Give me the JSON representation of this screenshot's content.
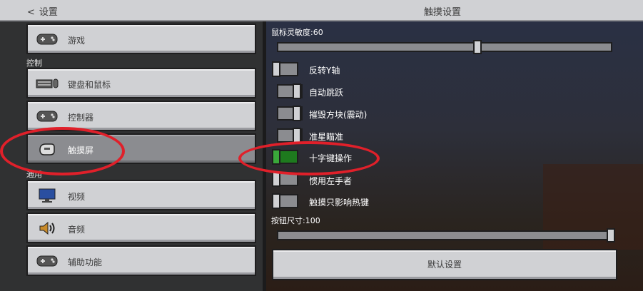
{
  "header": {
    "back_label": "设置",
    "title": "触摸设置"
  },
  "sidebar": {
    "section_control": "控制",
    "section_general": "通用",
    "items": [
      {
        "label": "游戏",
        "icon": "gamepad-icon"
      },
      {
        "label": "键盘和鼠标",
        "icon": "keyboard-icon"
      },
      {
        "label": "控制器",
        "icon": "controller-icon"
      },
      {
        "label": "触摸屏",
        "icon": "touch-hand-icon",
        "active": true
      },
      {
        "label": "视频",
        "icon": "monitor-icon"
      },
      {
        "label": "音频",
        "icon": "speaker-icon"
      },
      {
        "label": "辅助功能",
        "icon": "accessibility-controller-icon"
      }
    ]
  },
  "settings": {
    "mouse_sensitivity_label": "鼠标灵敏度:60",
    "mouse_sensitivity_value": 60,
    "toggles": [
      {
        "label": "反转Y轴",
        "on": false
      },
      {
        "label": "自动跳跃",
        "on": false
      },
      {
        "label": "摧毁方块(震动)",
        "on": false
      },
      {
        "label": "准星瞄准",
        "on": false
      },
      {
        "label": "十字键操作",
        "on": true
      },
      {
        "label": "惯用左手者",
        "on": false
      },
      {
        "label": "触摸只影响热键",
        "on": false
      }
    ],
    "button_size_label": "按钮尺寸:100",
    "button_size_value": 100,
    "default_button": "默认设置"
  },
  "colors": {
    "annotation": "#e0202a",
    "toggle_on": "#1e7a1e",
    "button_face": "#d0d1d4"
  }
}
